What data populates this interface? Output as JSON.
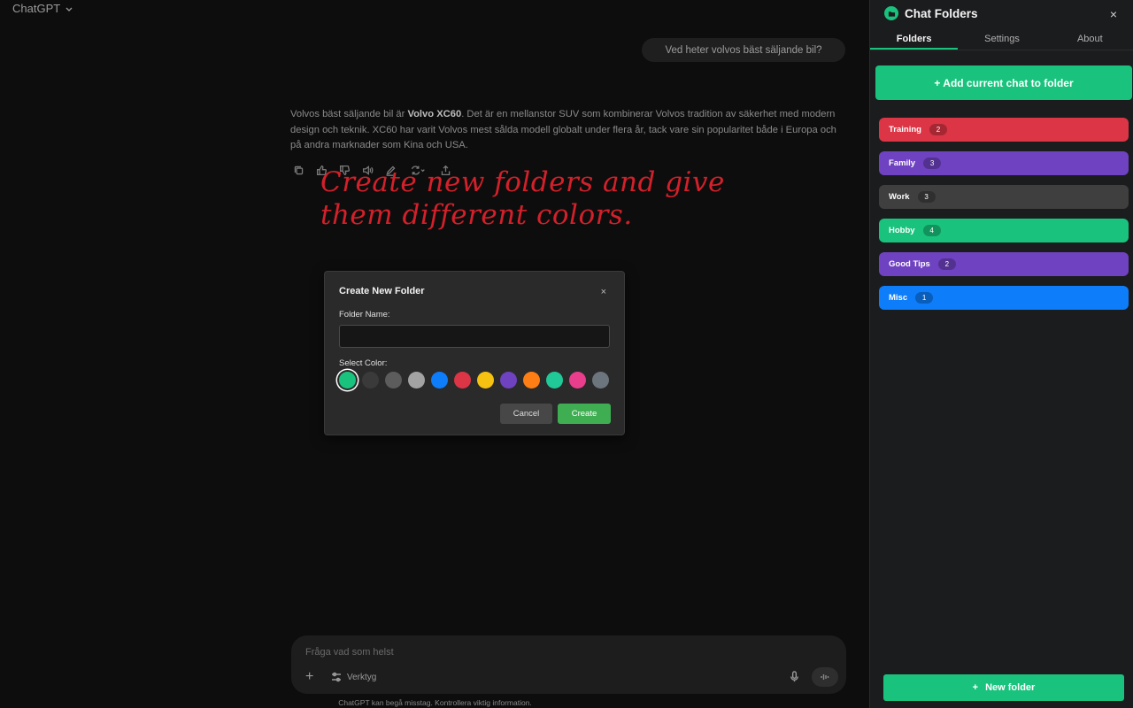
{
  "header": {
    "model_label": "ChatGPT"
  },
  "chat": {
    "user_message": "Ved heter volvos bäst säljande bil?",
    "assistant_parts": {
      "p1": "Volvos bäst säljande bil är ",
      "bold": "Volvo XC60",
      "p2": ". Det är en mellanstor SUV som kombinerar Volvos tradition av säkerhet med modern design och teknik. XC60 har varit Volvos mest sålda modell globalt under flera år, tack vare sin popularitet både i Europa och på andra marknader som Kina och USA."
    },
    "action_icons": [
      "copy-icon",
      "thumbs-up-icon",
      "thumbs-down-icon",
      "read-aloud-icon",
      "edit-icon",
      "regenerate-icon",
      "share-icon"
    ]
  },
  "annotation": {
    "line1": "Create new folders and give",
    "line2": "them different colors."
  },
  "modal": {
    "title": "Create New Folder",
    "close": "×",
    "folder_name_label": "Folder Name:",
    "folder_name_value": "",
    "select_color_label": "Select Color:",
    "colors": [
      "#19c37d",
      "#3a3a3a",
      "#5c5c5c",
      "#a3a3a3",
      "#0d7dfa",
      "#dc3545",
      "#f5c211",
      "#6f42c1",
      "#fd7e14",
      "#20c997",
      "#e83e8c",
      "#6c757d"
    ],
    "selected_color": "#19c37d",
    "cancel_label": "Cancel",
    "create_label": "Create"
  },
  "composer": {
    "placeholder": "Fråga vad som helst",
    "plus": "+",
    "tools_label": "Verktyg"
  },
  "disclaimer": "ChatGPT kan begå misstag. Kontrollera viktig information.",
  "sidebar": {
    "title": "Chat Folders",
    "close": "×",
    "tabs": [
      {
        "label": "Folders",
        "active": true
      },
      {
        "label": "Settings",
        "active": false
      },
      {
        "label": "About",
        "active": false
      }
    ],
    "add_button": "+ Add current chat to folder",
    "folders": [
      {
        "name": "Training",
        "count": "2",
        "color": "#dc3545"
      },
      {
        "name": "Family",
        "count": "3",
        "color": "#6f42c1"
      },
      {
        "name": "Work",
        "count": "3",
        "color": "#3f3f3f"
      },
      {
        "name": "Hobby",
        "count": "4",
        "color": "#19c37d"
      },
      {
        "name": "Good Tips",
        "count": "2",
        "color": "#6f42c1"
      },
      {
        "name": "Misc",
        "count": "1",
        "color": "#0d7dfa"
      }
    ],
    "new_folder_button": "New folder",
    "new_folder_plus": "+"
  }
}
